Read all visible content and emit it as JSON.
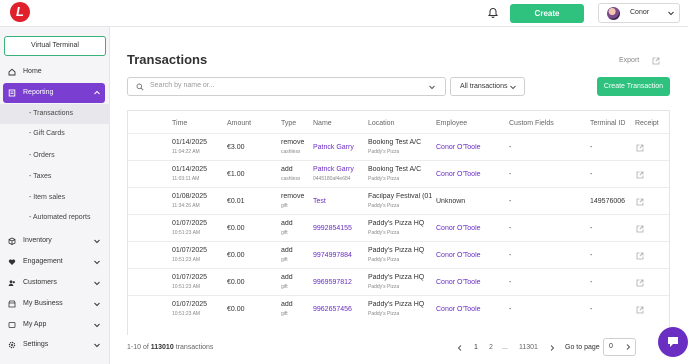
{
  "header": {
    "logo_letter": "L",
    "create_label": "Create",
    "user_name": "Conor"
  },
  "sidebar": {
    "virtual_terminal": "Virtual Terminal",
    "home": "Home",
    "reporting": "Reporting",
    "reporting_sub": [
      "- Transactions",
      "- Gift Cards",
      "- Orders",
      "- Taxes",
      "- Item sales",
      "- Automated reports"
    ],
    "inventory": "Inventory",
    "engagement": "Engagement",
    "customers": "Customers",
    "my_business": "My Business",
    "my_app": "My App",
    "settings": "Settings"
  },
  "main": {
    "title": "Transactions",
    "export_label": "Export",
    "search_placeholder": "Search by name or...",
    "filter_label": "All transactions",
    "create_transaction": "Create Transaction"
  },
  "table": {
    "headers": [
      "Time",
      "Amount",
      "Type",
      "Name",
      "Location",
      "Employee",
      "Custom Fields",
      "Terminal ID",
      "Receipt"
    ],
    "rows": [
      {
        "date": "01/14/2025",
        "time": "11:04:22 AM",
        "amount": "€3.00",
        "type": "remove",
        "type_sub": "cashless",
        "name": "Patrick Garry",
        "name_sub": "",
        "location": "Booking Test A/C",
        "location_sub": "Paddy's Pizza",
        "employee": "Conor O'Toole",
        "custom": "-",
        "terminal": "-"
      },
      {
        "date": "01/14/2025",
        "time": "11:03:11 AM",
        "amount": "€1.00",
        "type": "add",
        "type_sub": "cashless",
        "name": "Patrick Garry",
        "name_sub": "0445180af4e684",
        "location": "Booking Test A/C",
        "location_sub": "Paddy's Pizza",
        "employee": "Conor O'Toole",
        "custom": "-",
        "terminal": "-"
      },
      {
        "date": "01/08/2025",
        "time": "11:34:26 AM",
        "amount": "€0.01",
        "type": "remove",
        "type_sub": "gift",
        "name": "Test",
        "name_sub": "",
        "location": "Facilpay Festival (01",
        "location_sub": "Paddy's Pizza",
        "employee": "Unknown",
        "custom": "-",
        "terminal": "149576006"
      },
      {
        "date": "01/07/2025",
        "time": "10:51:23 AM",
        "amount": "€0.00",
        "type": "add",
        "type_sub": "gift",
        "name": "9992854155",
        "name_sub": "",
        "location": "Paddy's Pizza HQ",
        "location_sub": "Paddy's Pizza",
        "employee": "Conor O'Toole",
        "custom": "-",
        "terminal": "-"
      },
      {
        "date": "01/07/2025",
        "time": "10:51:23 AM",
        "amount": "€0.00",
        "type": "add",
        "type_sub": "gift",
        "name": "9974997884",
        "name_sub": "",
        "location": "Paddy's Pizza HQ",
        "location_sub": "Paddy's Pizza",
        "employee": "Conor O'Toole",
        "custom": "-",
        "terminal": "-"
      },
      {
        "date": "01/07/2025",
        "time": "10:51:23 AM",
        "amount": "€0.00",
        "type": "add",
        "type_sub": "gift",
        "name": "9969597812",
        "name_sub": "",
        "location": "Paddy's Pizza HQ",
        "location_sub": "Paddy's Pizza",
        "employee": "Conor O'Toole",
        "custom": "-",
        "terminal": "-"
      },
      {
        "date": "01/07/2025",
        "time": "10:51:23 AM",
        "amount": "€0.00",
        "type": "add",
        "type_sub": "gift",
        "name": "9962657456",
        "name_sub": "",
        "location": "Paddy's Pizza HQ",
        "location_sub": "Paddy's Pizza",
        "employee": "Conor O'Toole",
        "custom": "-",
        "terminal": "-"
      }
    ]
  },
  "footer": {
    "count_prefix": "1-10 of",
    "count_total": "113010",
    "count_suffix": "transactions",
    "pages": [
      "1",
      "2",
      "...",
      "11301"
    ],
    "goto_label": "Go to page",
    "goto_value": "0"
  },
  "colors": {
    "accent_purple": "#7a3fd0",
    "link_purple": "#6a2fc2",
    "create_green": "#2ec27e",
    "logo_red": "#e0212b"
  }
}
